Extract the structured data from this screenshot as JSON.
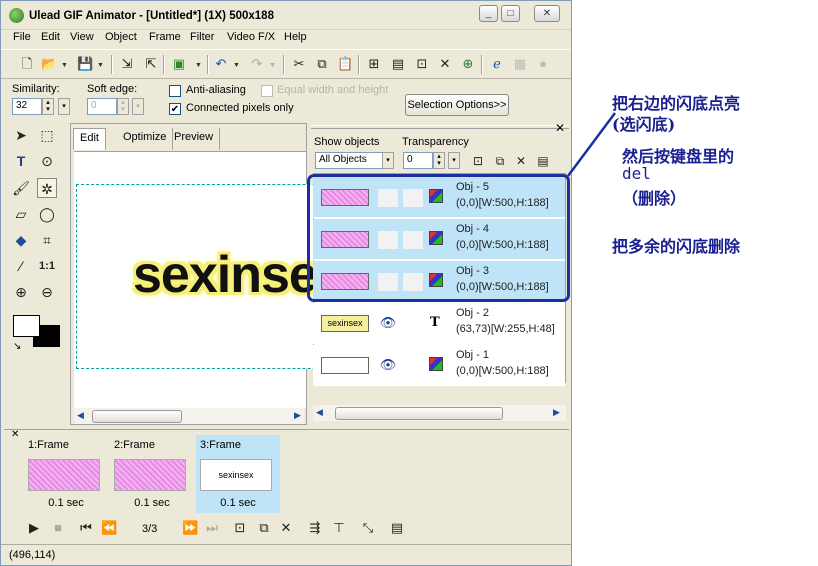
{
  "window": {
    "title": "Ulead GIF Animator - [Untitled*] (1X) 500x188"
  },
  "menu": [
    "File",
    "Edit",
    "View",
    "Object",
    "Frame",
    "Filter",
    "Video F/X",
    "Help"
  ],
  "options": {
    "similarity_label": "Similarity:",
    "similarity_value": "32",
    "soft_edge_label": "Soft edge:",
    "soft_edge_value": "0",
    "anti_aliasing": "Anti-aliasing",
    "equal_wh": "Equal width and height",
    "connected": "Connected pixels only",
    "selection_options": "Selection Options>>"
  },
  "work_tabs": [
    "Edit",
    "Optimize",
    "Preview"
  ],
  "canvas_text": "sexinsex",
  "objects_panel": {
    "show_objects_label": "Show objects",
    "show_objects_value": "All Objects",
    "transparency_label": "Transparency",
    "transparency_value": "0",
    "items": [
      {
        "name": "Obj - 5",
        "pos": "(0,0)[W:500,H:188]"
      },
      {
        "name": "Obj - 4",
        "pos": "(0,0)[W:500,H:188]"
      },
      {
        "name": "Obj - 3",
        "pos": "(0,0)[W:500,H:188]"
      },
      {
        "name": "Obj - 2",
        "pos": "(63,73)[W:255,H:48]",
        "thumb_text": "sexinsex"
      },
      {
        "name": "Obj - 1",
        "pos": "(0,0)[W:500,H:188]"
      }
    ]
  },
  "frames": [
    {
      "label": "1:Frame",
      "delay": "0.1 sec"
    },
    {
      "label": "2:Frame",
      "delay": "0.1 sec"
    },
    {
      "label": "3:Frame",
      "delay": "0.1 sec",
      "thumb_text": "sexinsex"
    }
  ],
  "frame_counter": "3/3",
  "status_text": "(496,114)",
  "annotations": {
    "line1": "把右边的闪底点亮",
    "line2": "(选闪底)",
    "line3": "然后按键盘里的",
    "line4": "del",
    "line5": "（删除）",
    "line6": "把多余的闪底删除"
  },
  "colors": {
    "highlight_border": "#1a2fa0",
    "selected_row": "#bfe3f7",
    "annotation_text": "#1a1f8f"
  }
}
